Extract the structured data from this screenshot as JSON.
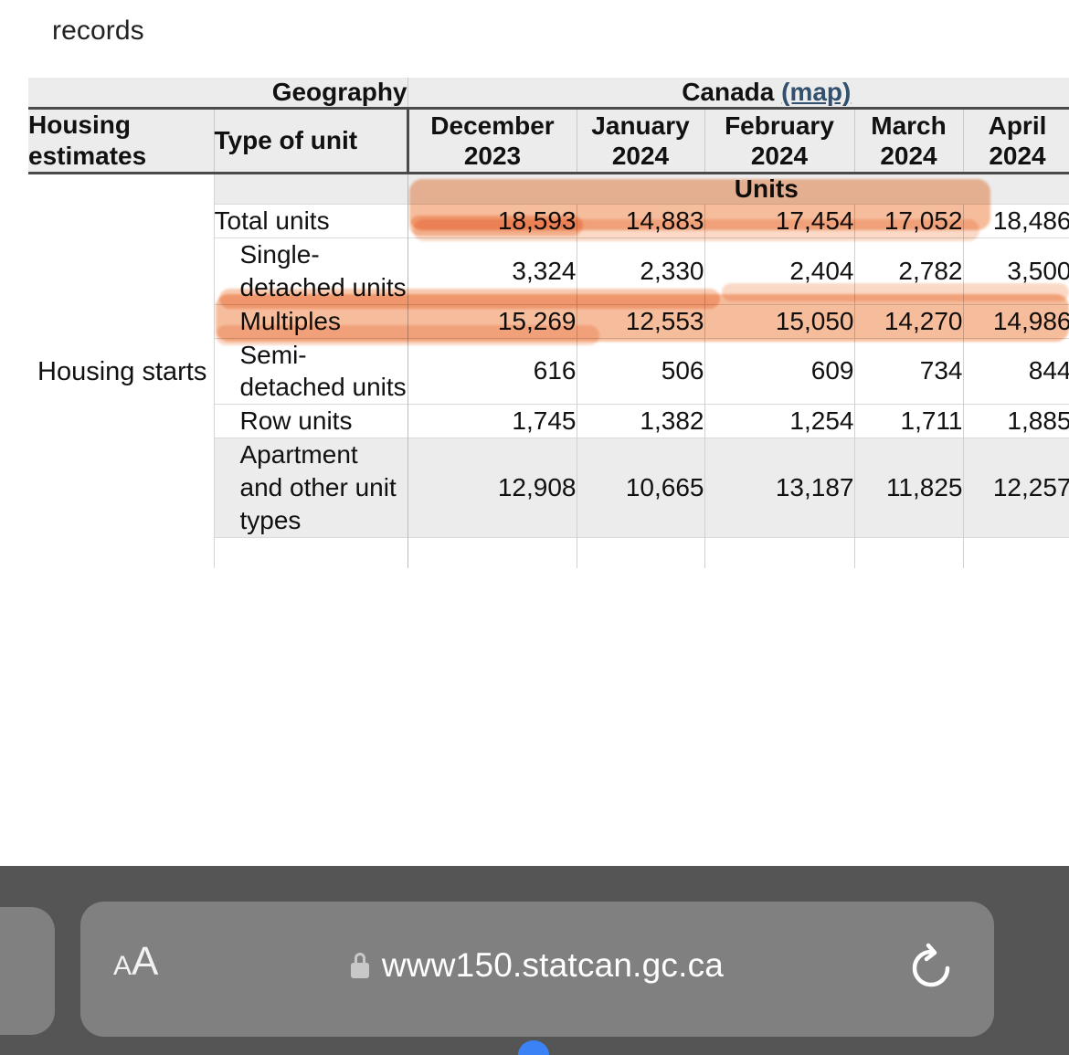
{
  "page": {
    "preamble_text": "records"
  },
  "table": {
    "geography_label": "Geography",
    "geography_value": "Canada",
    "map_link": "(map)",
    "housing_estimates_label": "Housing estimates",
    "type_of_unit_label": "Type of unit",
    "units_label": "Units",
    "row_group_label": "Housing starts",
    "columns": [
      {
        "month": "December",
        "year": "2023"
      },
      {
        "month": "January",
        "year": "2024"
      },
      {
        "month": "February",
        "year": "2024"
      },
      {
        "month": "March",
        "year": "2024"
      },
      {
        "month": "April",
        "year": "2024"
      }
    ],
    "rows": [
      {
        "label": "Total units",
        "values": [
          "18,593",
          "14,883",
          "17,454",
          "17,052",
          "18,486"
        ]
      },
      {
        "label": "Single-detached units",
        "values": [
          "3,324",
          "2,330",
          "2,404",
          "2,782",
          "3,500"
        ]
      },
      {
        "label": "Multiples",
        "values": [
          "15,269",
          "12,553",
          "15,050",
          "14,270",
          "14,986"
        ]
      },
      {
        "label": "Semi-detached units",
        "values": [
          "616",
          "506",
          "609",
          "734",
          "844"
        ]
      },
      {
        "label": "Row units",
        "values": [
          "1,745",
          "1,382",
          "1,254",
          "1,711",
          "1,885"
        ]
      },
      {
        "label": "Apartment and other unit types",
        "values": [
          "12,908",
          "10,665",
          "13,187",
          "11,825",
          "12,257"
        ]
      }
    ]
  },
  "browser": {
    "text_size_button": "AA",
    "text_size_small": "A",
    "text_size_large": "A",
    "url": "www150.statcan.gc.ca",
    "lock_icon": "lock-icon",
    "reload_icon": "reload-icon"
  },
  "colors": {
    "highlighter": "#f4ab80",
    "header_background": "#ececec",
    "link": "#31506f",
    "toolbar_background": "#555555",
    "urlbar_background": "#808080"
  }
}
